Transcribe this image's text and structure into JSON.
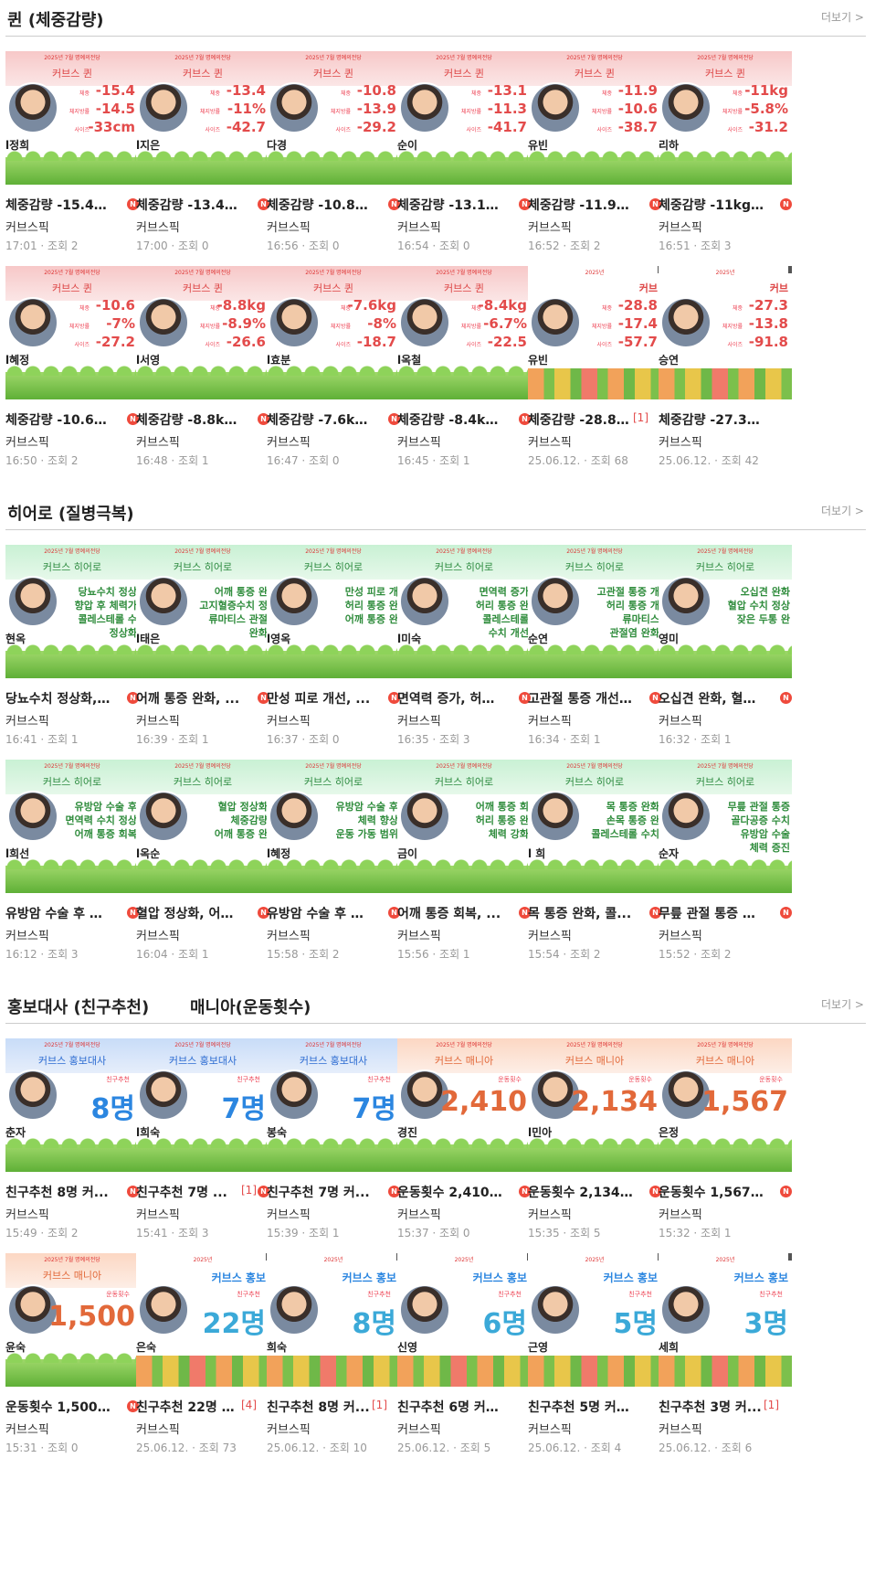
{
  "more_label": "더보기 >",
  "author": "커브스픽",
  "new_badge": "N",
  "sections": [
    {
      "title": "퀸 (체중감량)",
      "theme": "queen",
      "cards": [
        {
          "title": "체중감량 -15.4kg...",
          "meta": "17:01 · 조회 2",
          "name": "l정희",
          "kind": "stats",
          "stats": [
            [
              "체중",
              "-15.4"
            ],
            [
              "체지방률",
              "-14.5"
            ],
            [
              "사이즈",
              "-33cm"
            ]
          ],
          "band_small": "2025년 7월 명예의전당",
          "band_title": "커브스 퀸",
          "new": true
        },
        {
          "title": "체중감량 -13.4kg...",
          "meta": "17:00 · 조회 0",
          "name": "l지은",
          "kind": "stats",
          "stats": [
            [
              "체중",
              "-13.4"
            ],
            [
              "체지방률",
              "-11%"
            ],
            [
              "사이즈",
              "-42.7"
            ]
          ],
          "band_small": "2025년 7월 명예의전당",
          "band_title": "커브스 퀸",
          "new": true
        },
        {
          "title": "체중감량 -10.8kg...",
          "meta": "16:56 · 조회 0",
          "name": "다경",
          "kind": "stats",
          "stats": [
            [
              "체중",
              "-10.8"
            ],
            [
              "체지방률",
              "-13.9"
            ],
            [
              "사이즈",
              "-29.2"
            ]
          ],
          "band_small": "2025년 7월 명예의전당",
          "band_title": "커브스 퀸",
          "new": true
        },
        {
          "title": "체중감량 -13.1kg...",
          "meta": "16:54 · 조회 0",
          "name": "순이",
          "kind": "stats",
          "stats": [
            [
              "체중",
              "-13.1"
            ],
            [
              "체지방률",
              "-11.3"
            ],
            [
              "사이즈",
              "-41.7"
            ]
          ],
          "band_small": "2025년 7월 명예의전당",
          "band_title": "커브스 퀸",
          "new": true
        },
        {
          "title": "체중감량 -11.9kg...",
          "meta": "16:52 · 조회 2",
          "name": "유빈",
          "kind": "stats",
          "stats": [
            [
              "체중",
              "-11.9"
            ],
            [
              "체지방률",
              "-10.6"
            ],
            [
              "사이즈",
              "-38.7"
            ]
          ],
          "band_small": "2025년 7월 명예의전당",
          "band_title": "커브스 퀸",
          "new": true
        },
        {
          "title": "체중감량 -11kg ...",
          "meta": "16:51 · 조회 3",
          "name": "리하",
          "kind": "stats",
          "stats": [
            [
              "체중",
              "-11kg"
            ],
            [
              "체지방률",
              "-5.8%"
            ],
            [
              "사이즈",
              "-31.2"
            ]
          ],
          "band_small": "2025년 7월 명예의전당",
          "band_title": "커브스 퀸",
          "new": true
        },
        {
          "title": "체중감량 -10.6kg...",
          "meta": "16:50 · 조회 2",
          "name": "l혜정",
          "kind": "stats",
          "stats": [
            [
              "체중",
              "-10.6"
            ],
            [
              "체지방률",
              "-7%"
            ],
            [
              "사이즈",
              "-27.2"
            ]
          ],
          "band_small": "2025년 7월 명예의전당",
          "band_title": "커브스 퀸",
          "new": true
        },
        {
          "title": "체중감량 -8.8kg ...",
          "meta": "16:48 · 조회 1",
          "name": "l서영",
          "kind": "stats",
          "stats": [
            [
              "체중",
              "-8.8kg"
            ],
            [
              "체지방률",
              "-8.9%"
            ],
            [
              "사이즈",
              "-26.6"
            ]
          ],
          "band_small": "2025년 7월 명예의전당",
          "band_title": "커브스 퀸",
          "new": true
        },
        {
          "title": "체중감량 -7.6kg ...",
          "meta": "16:47 · 조회 0",
          "name": "l효분",
          "kind": "stats",
          "stats": [
            [
              "체중",
              "-7.6kg"
            ],
            [
              "체지방률",
              "-8%"
            ],
            [
              "사이즈",
              "-18.7"
            ]
          ],
          "band_small": "2025년 7월 명예의전당",
          "band_title": "커브스 퀸",
          "new": true
        },
        {
          "title": "체중감량 -8.4kg ...",
          "meta": "16:45 · 조회 1",
          "name": "l옥철",
          "kind": "stats",
          "stats": [
            [
              "체중",
              "-8.4kg"
            ],
            [
              "체지방률",
              "-6.7%"
            ],
            [
              "사이즈",
              "-22.5"
            ]
          ],
          "band_small": "2025년 7월 명예의전당",
          "band_title": "커브스 퀸",
          "new": true
        },
        {
          "title": "체중감량 -28.8kg...",
          "meta": "25.06.12. · 조회 68",
          "name": "유빈",
          "kind": "stats2",
          "stats": [
            [
              "체중",
              "-28.8"
            ],
            [
              "체지방률",
              "-17.4"
            ],
            [
              "사이즈",
              "-57.7"
            ]
          ],
          "band_small": "2025년",
          "band_title": "커브",
          "new": false,
          "count": "[1]"
        },
        {
          "title": "체중감량 -27.3kg ...",
          "meta": "25.06.12. · 조회 42",
          "name": "승연",
          "kind": "stats2",
          "stats": [
            [
              "체중",
              "-27.3"
            ],
            [
              "체지방률",
              "-13.8"
            ],
            [
              "사이즈",
              "-91.8"
            ]
          ],
          "band_small": "2025년",
          "band_title": "커브",
          "new": false
        }
      ]
    },
    {
      "title": "히어로 (질병극복)",
      "theme": "hero",
      "cards": [
        {
          "title": "당뇨수치 정상화, ...",
          "meta": "16:41 · 조회 1",
          "name": "현옥",
          "kind": "effects",
          "effects": [
            "당뇨수치 정상",
            "향압 후 체력가",
            "콜레스테롤 수",
            "정상화"
          ],
          "band_small": "2025년 7월 명예의전당",
          "band_title": "커브스 히어로",
          "new": true
        },
        {
          "title": "어깨 통증 완화, ...",
          "meta": "16:39 · 조회 1",
          "name": "l태은",
          "kind": "effects",
          "effects": [
            "어깨 통증 완",
            "고지혈증수치 정",
            "류마티스 관절",
            "완화"
          ],
          "band_small": "2025년 7월 명예의전당",
          "band_title": "커브스 히어로",
          "new": true
        },
        {
          "title": "만성 피로 개선, ...",
          "meta": "16:37 · 조회 0",
          "name": "l영옥",
          "kind": "effects",
          "effects": [
            "만성 피로 개",
            "허리 통증 완",
            "어깨 통증 완"
          ],
          "band_small": "2025년 7월 명예의전당",
          "band_title": "커브스 히어로",
          "new": true
        },
        {
          "title": "면역력 증가, 허리...",
          "meta": "16:35 · 조회 3",
          "name": "l미숙",
          "kind": "effects",
          "effects": [
            "면역력 증가",
            "허리 통증 완",
            "콜레스테롤",
            "수치 개선"
          ],
          "band_small": "2025년 7월 명예의전당",
          "band_title": "커브스 히어로",
          "new": true
        },
        {
          "title": "고관절 통증 개선,...",
          "meta": "16:34 · 조회 1",
          "name": "순연",
          "kind": "effects",
          "effects": [
            "고관절 통증 개",
            "허리 통증 개",
            "류마티스",
            "관절염 완화"
          ],
          "band_small": "2025년 7월 명예의전당",
          "band_title": "커브스 히어로",
          "new": true
        },
        {
          "title": "오십견 완화, 혈압...",
          "meta": "16:32 · 조회 1",
          "name": "영미",
          "kind": "effects",
          "effects": [
            "오십견 완화",
            "혈압 수치 정상",
            "잦은 두통 완"
          ],
          "band_small": "2025년 7월 명예의전당",
          "band_title": "커브스 히어로",
          "new": true
        },
        {
          "title": "유방암 수술 후 극...",
          "meta": "16:12 · 조회 3",
          "name": "l희선",
          "kind": "effects",
          "effects": [
            "유방암 수술 후",
            "면역력 수치 정상",
            "어깨 통증 회복"
          ],
          "band_small": "2025년 7월 명예의전당",
          "band_title": "커브스 히어로",
          "new": true
        },
        {
          "title": "혈압 정상화, 어깨...",
          "meta": "16:04 · 조회 1",
          "name": "l옥순",
          "kind": "effects",
          "effects": [
            "혈압 정상화",
            "체중감량",
            "어깨 통증 완"
          ],
          "band_small": "2025년 7월 명예의전당",
          "band_title": "커브스 히어로",
          "new": true
        },
        {
          "title": "유방암 수술 후 체...",
          "meta": "15:58 · 조회 2",
          "name": "l혜정",
          "kind": "effects",
          "effects": [
            "유방암 수술 후",
            "체력 향상",
            "운동 가동 범위"
          ],
          "band_small": "2025년 7월 명예의전당",
          "band_title": "커브스 히어로",
          "new": true
        },
        {
          "title": "어깨 통증 회복, ...",
          "meta": "15:56 · 조회 1",
          "name": "금이",
          "kind": "effects",
          "effects": [
            "어깨 통증 회",
            "허리 통증 완",
            "체력 강화"
          ],
          "band_small": "2025년 7월 명예의전당",
          "band_title": "커브스 히어로",
          "new": true
        },
        {
          "title": "목 통증 완화, 콜...",
          "meta": "15:54 · 조회 2",
          "name": "l 희",
          "kind": "effects",
          "effects": [
            "목 통증 완화",
            "손목 통증 완",
            "콜레스테롤 수치"
          ],
          "band_small": "2025년 7월 명예의전당",
          "band_title": "커브스 히어로",
          "new": true
        },
        {
          "title": "무릎 관절 통증 개...",
          "meta": "15:52 · 조회 2",
          "name": "순자",
          "kind": "effects",
          "effects": [
            "무릎 관절 통증",
            "골다공증 수치",
            "유방암 수술",
            "체력 증진"
          ],
          "band_small": "2025년 7월 명예의전당",
          "band_title": "커브스 히어로",
          "new": true
        }
      ]
    },
    {
      "title": "홍보대사 (친구추천)",
      "title2": "매니아(운동횟수)",
      "theme": "promo",
      "cards": [
        {
          "title": "친구추천 8명 커...",
          "meta": "15:49 · 조회 2",
          "name": "춘자",
          "kind": "count",
          "theme": "promo",
          "count_label": "친구추천",
          "count_value": "8명",
          "band_small": "2025년 7월 명예의전당",
          "band_title": "커브스 홍보대사",
          "new": true
        },
        {
          "title": "친구추천 7명 ...",
          "meta": "15:41 · 조회 3",
          "name": "l희숙",
          "kind": "count",
          "theme": "promo",
          "count_label": "친구추천",
          "count_value": "7명",
          "band_small": "2025년 7월 명예의전당",
          "band_title": "커브스 홍보대사",
          "new": true,
          "count": "[1]"
        },
        {
          "title": "친구추천 7명 커...",
          "meta": "15:39 · 조회 1",
          "name": "봉숙",
          "kind": "count",
          "theme": "promo",
          "count_label": "친구추천",
          "count_value": "7명",
          "band_small": "2025년 7월 명예의전당",
          "band_title": "커브스 홍보대사",
          "new": true
        },
        {
          "title": "운동횟수 2,410회...",
          "meta": "15:37 · 조회 0",
          "name": "경진",
          "kind": "count",
          "theme": "mania",
          "count_label": "운동횟수",
          "count_value": "2,410",
          "band_small": "2025년 7월 명예의전당",
          "band_title": "커브스 매니아",
          "new": true
        },
        {
          "title": "운동횟수 2,134회...",
          "meta": "15:35 · 조회 5",
          "name": "l민아",
          "kind": "count",
          "theme": "mania",
          "count_label": "운동횟수",
          "count_value": "2,134",
          "band_small": "2025년 7월 명예의전당",
          "band_title": "커브스 매니아",
          "new": true
        },
        {
          "title": "운동횟수 1,567회...",
          "meta": "15:32 · 조회 1",
          "name": "은정",
          "kind": "count",
          "theme": "mania",
          "count_label": "운동횟수",
          "count_value": "1,567",
          "band_small": "2025년 7월 명예의전당",
          "band_title": "커브스 매니아",
          "new": true
        },
        {
          "title": "운동횟수 1,500회...",
          "meta": "15:31 · 조회 0",
          "name": "윤숙",
          "kind": "count",
          "theme": "mania",
          "count_label": "운동횟수",
          "count_value": "1,500",
          "band_small": "2025년 7월 명예의전당",
          "band_title": "커브스 매니아",
          "new": true
        },
        {
          "title": "친구추천 22명 커...",
          "meta": "25.06.12. · 조회 73",
          "name": "은숙",
          "kind": "count",
          "theme": "promo2",
          "count_label": "친구추천",
          "count_value": "22명",
          "band_small": "2025년",
          "band_title": "커브스 홍보",
          "new": false,
          "count": "[4]"
        },
        {
          "title": "친구추천 8명 커...",
          "meta": "25.06.12. · 조회 10",
          "name": "희숙",
          "kind": "count",
          "theme": "promo2",
          "count_label": "친구추천",
          "count_value": "8명",
          "band_small": "2025년",
          "band_title": "커브스 홍보",
          "new": false,
          "count": "[1]"
        },
        {
          "title": "친구추천 6명 커브...",
          "meta": "25.06.12. · 조회 5",
          "name": "신영",
          "kind": "count",
          "theme": "promo2",
          "count_label": "친구추천",
          "count_value": "6명",
          "band_small": "2025년",
          "band_title": "커브스 홍보",
          "new": false
        },
        {
          "title": "친구추천 5명 커브...",
          "meta": "25.06.12. · 조회 4",
          "name": "근영",
          "kind": "count",
          "theme": "promo2",
          "count_label": "친구추천",
          "count_value": "5명",
          "band_small": "2025년",
          "band_title": "커브스 홍보",
          "new": false
        },
        {
          "title": "친구추천 3명 커...",
          "meta": "25.06.12. · 조회 6",
          "name": "세희",
          "kind": "count",
          "theme": "promo2",
          "count_label": "친구추천",
          "count_value": "3명",
          "band_small": "2025년",
          "band_title": "커브스 홍보",
          "new": false,
          "count": "[1]"
        }
      ]
    }
  ]
}
